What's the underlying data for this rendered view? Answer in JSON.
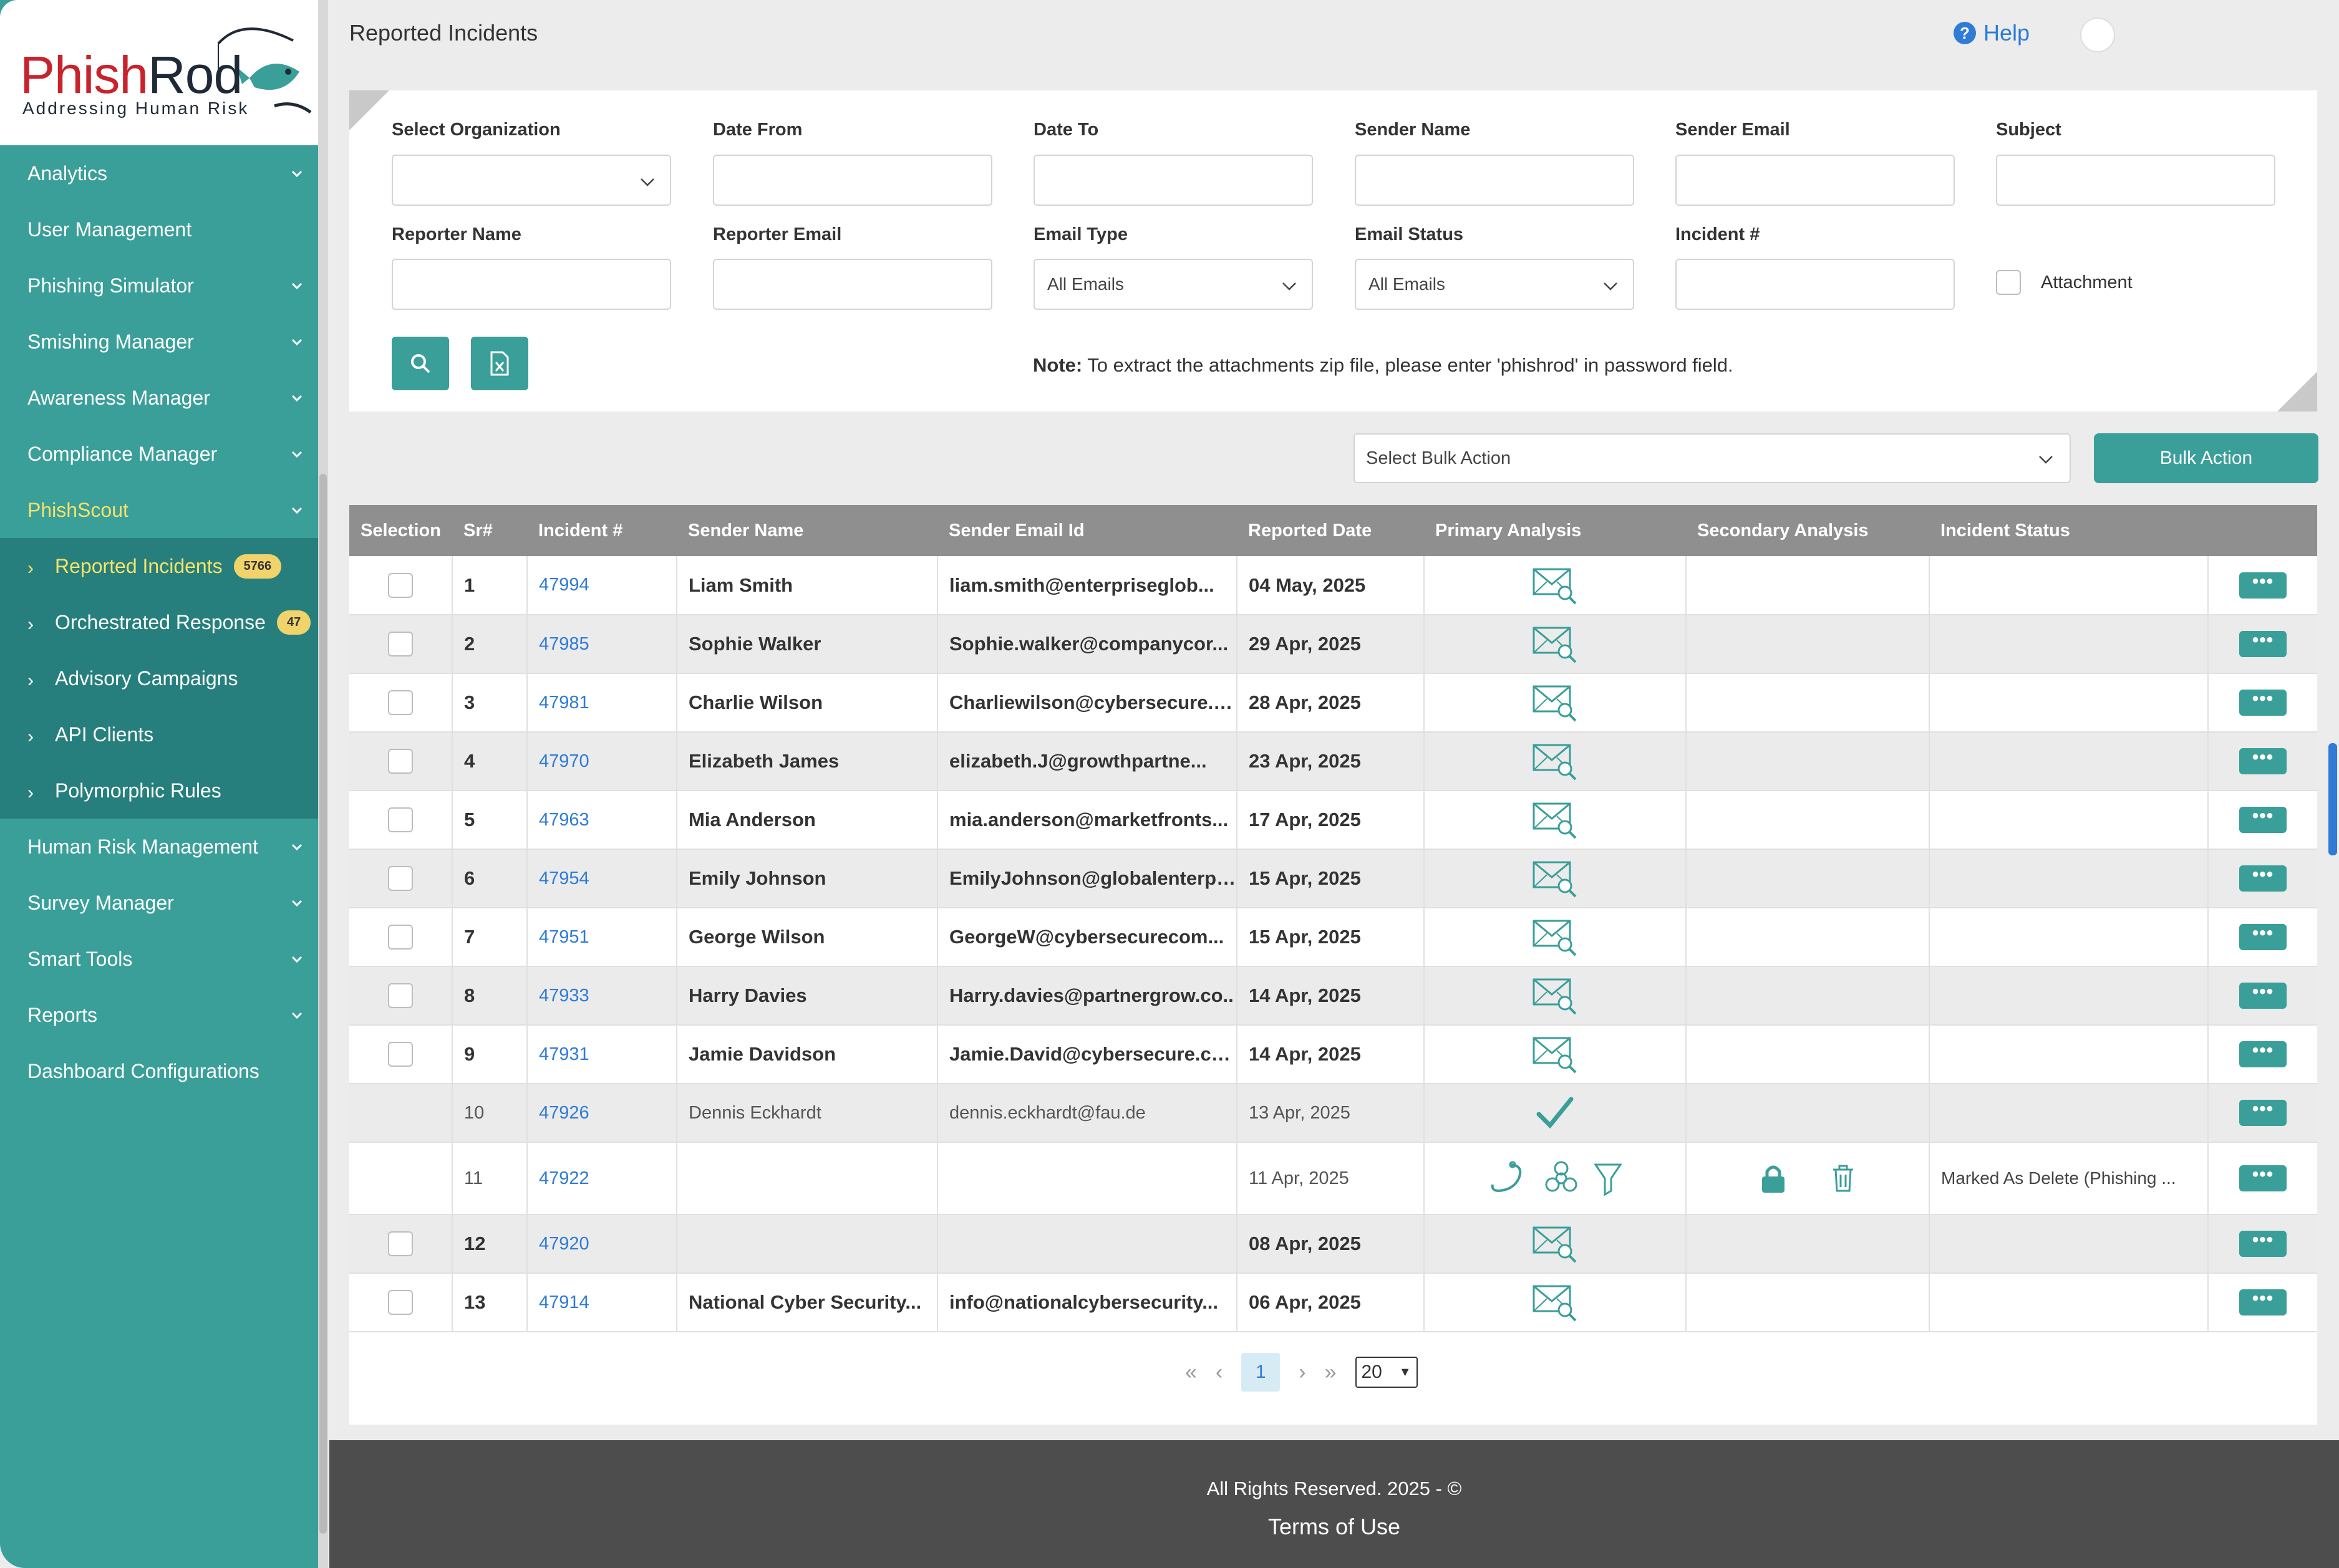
{
  "brand": {
    "name_part1": "Phish",
    "name_part2": "Rod",
    "tagline": "Addressing Human Risk",
    "accent": "#3a9e99",
    "highlight": "#f4e26a"
  },
  "sidebar": {
    "items": [
      {
        "label": "Analytics",
        "expandable": true
      },
      {
        "label": "User Management",
        "expandable": false
      },
      {
        "label": "Phishing Simulator",
        "expandable": true
      },
      {
        "label": "Smishing Manager",
        "expandable": true
      },
      {
        "label": "Awareness Manager",
        "expandable": true
      },
      {
        "label": "Compliance Manager",
        "expandable": true
      },
      {
        "label": "PhishScout",
        "expandable": true
      }
    ],
    "sub_items": [
      {
        "label": "Reported Incidents",
        "badge": "5766"
      },
      {
        "label": "Orchestrated Response",
        "badge": "47"
      },
      {
        "label": "Advisory Campaigns"
      },
      {
        "label": "API Clients"
      },
      {
        "label": "Polymorphic Rules"
      }
    ],
    "items_after": [
      {
        "label": "Human Risk Management",
        "expandable": true
      },
      {
        "label": "Survey Manager",
        "expandable": true
      },
      {
        "label": "Smart Tools",
        "expandable": true
      },
      {
        "label": "Reports",
        "expandable": true
      },
      {
        "label": "Dashboard Configurations",
        "expandable": false
      }
    ]
  },
  "header": {
    "title": "Reported Incidents",
    "help_label": "Help"
  },
  "filters": {
    "select_organization": {
      "label": "Select Organization",
      "value": ""
    },
    "date_from": {
      "label": "Date From",
      "value": ""
    },
    "date_to": {
      "label": "Date To",
      "value": ""
    },
    "sender_name": {
      "label": "Sender Name",
      "value": ""
    },
    "sender_email": {
      "label": "Sender Email",
      "value": ""
    },
    "subject": {
      "label": "Subject",
      "value": ""
    },
    "reporter_name": {
      "label": "Reporter Name",
      "value": ""
    },
    "reporter_email": {
      "label": "Reporter Email",
      "value": ""
    },
    "email_type": {
      "label": "Email Type",
      "value": "All Emails"
    },
    "email_status": {
      "label": "Email Status",
      "value": "All Emails"
    },
    "incident_no": {
      "label": "Incident #",
      "value": ""
    },
    "attachment": {
      "label": "Attachment",
      "checked": false
    },
    "note_label": "Note:",
    "note_text": " To extract the attachments zip file, please enter 'phishrod' in password field."
  },
  "bulk": {
    "placeholder": "Select Bulk Action",
    "button": "Bulk Action"
  },
  "table": {
    "columns": [
      "Selection",
      "Sr#",
      "Incident #",
      "Sender Name",
      "Sender Email Id",
      "Reported Date",
      "Primary Analysis",
      "Secondary Analysis",
      "Incident Status"
    ],
    "rows": [
      {
        "sr": "1",
        "incident": "47994",
        "sender": "Liam Smith",
        "email": "liam.smith@enterpriseglob...",
        "date": "04 May, 2025",
        "primary": "mail-search",
        "status": "",
        "selectable": true,
        "style": "bold"
      },
      {
        "sr": "2",
        "incident": "47985",
        "sender": "Sophie Walker",
        "email": "Sophie.walker@companycor...",
        "date": "29 Apr, 2025",
        "primary": "mail-search",
        "status": "",
        "selectable": true,
        "style": "bold"
      },
      {
        "sr": "3",
        "incident": "47981",
        "sender": "Charlie Wilson",
        "email": "Charliewilson@cybersecure.c...",
        "date": "28 Apr, 2025",
        "primary": "mail-search",
        "status": "",
        "selectable": true,
        "style": "bold"
      },
      {
        "sr": "4",
        "incident": "47970",
        "sender": "Elizabeth James",
        "email": "elizabeth.J@growthpartne...",
        "date": "23 Apr, 2025",
        "primary": "mail-search",
        "status": "",
        "selectable": true,
        "style": "bold"
      },
      {
        "sr": "5",
        "incident": "47963",
        "sender": "Mia Anderson",
        "email": "mia.anderson@marketfronts...",
        "date": "17 Apr, 2025",
        "primary": "mail-search",
        "status": "",
        "selectable": true,
        "style": "bold"
      },
      {
        "sr": "6",
        "incident": "47954",
        "sender": "Emily Johnson",
        "email": "EmilyJohnson@globalenterp....",
        "date": "15 Apr, 2025",
        "primary": "mail-search",
        "status": "",
        "selectable": true,
        "style": "bold"
      },
      {
        "sr": "7",
        "incident": "47951",
        "sender": "George Wilson",
        "email": "GeorgeW@cybersecurecom...",
        "date": "15 Apr, 2025",
        "primary": "mail-search",
        "status": "",
        "selectable": true,
        "style": "bold"
      },
      {
        "sr": "8",
        "incident": "47933",
        "sender": "Harry Davies",
        "email": "Harry.davies@partnergrow.co..",
        "date": "14 Apr, 2025",
        "primary": "mail-search",
        "status": "",
        "selectable": true,
        "style": "bold"
      },
      {
        "sr": "9",
        "incident": "47931",
        "sender": "Jamie Davidson",
        "email": "Jamie.David@cybersecure.com",
        "date": "14 Apr, 2025",
        "primary": "mail-search",
        "status": "",
        "selectable": true,
        "style": "bold"
      },
      {
        "sr": "10",
        "incident": "47926",
        "sender": "Dennis Eckhardt",
        "email": "dennis.eckhardt@fau.de",
        "date": "13 Apr, 2025",
        "primary": "check",
        "status": "",
        "selectable": false,
        "style": "light"
      },
      {
        "sr": "11",
        "incident": "47922",
        "sender": "",
        "email": "",
        "date": "11 Apr, 2025",
        "primary": "hook-biohazard-funnel",
        "secondary": "lock-trash",
        "status": "Marked As Delete (Phishing ...",
        "selectable": false,
        "style": "light"
      },
      {
        "sr": "12",
        "incident": "47920",
        "sender": "",
        "email": "",
        "date": "08 Apr, 2025",
        "primary": "mail-search",
        "status": "",
        "selectable": true,
        "style": "bold"
      },
      {
        "sr": "13",
        "incident": "47914",
        "sender": "National Cyber Security...",
        "email": "info@nationalcybersecurity...",
        "date": "06 Apr, 2025",
        "primary": "mail-search",
        "status": "",
        "selectable": true,
        "style": "bold"
      }
    ]
  },
  "pagination": {
    "current_page": "1",
    "page_size": "20"
  },
  "footer": {
    "rights": "All Rights Reserved. 2025 - ©",
    "terms": "Terms of Use"
  }
}
